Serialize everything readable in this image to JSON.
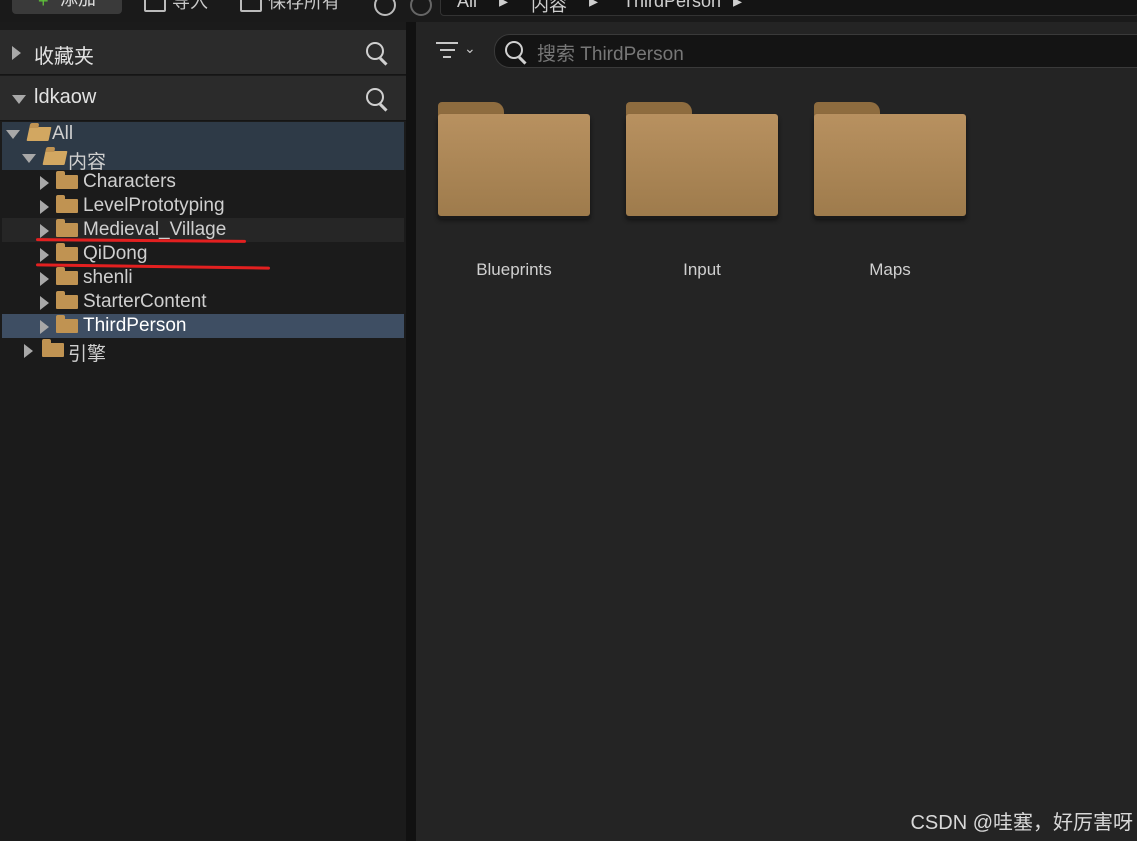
{
  "toolbar": {
    "add_label": "添加",
    "import_label": "导入",
    "save_all_label": "保存所有"
  },
  "breadcrumb": [
    "All",
    "内容",
    "ThirdPerson"
  ],
  "left_panel": {
    "favorites_title": "收藏夹",
    "project_title": "ldkaow",
    "tree": {
      "root": "All",
      "content": "内容",
      "children": [
        "Characters",
        "LevelPrototyping",
        "Medieval_Village",
        "QiDong",
        "shenli",
        "StarterContent",
        "ThirdPerson"
      ],
      "selected": "ThirdPerson",
      "engine": "引擎"
    }
  },
  "right_panel": {
    "search_placeholder": "搜索 ThirdPerson",
    "folders": [
      "Blueprints",
      "Input",
      "Maps"
    ]
  },
  "watermark": "CSDN @哇塞，好厉害呀",
  "colors": {
    "background": "#202020",
    "folder": "#c09352",
    "selection": "#3e4e63",
    "annotation_red": "#e32020"
  }
}
